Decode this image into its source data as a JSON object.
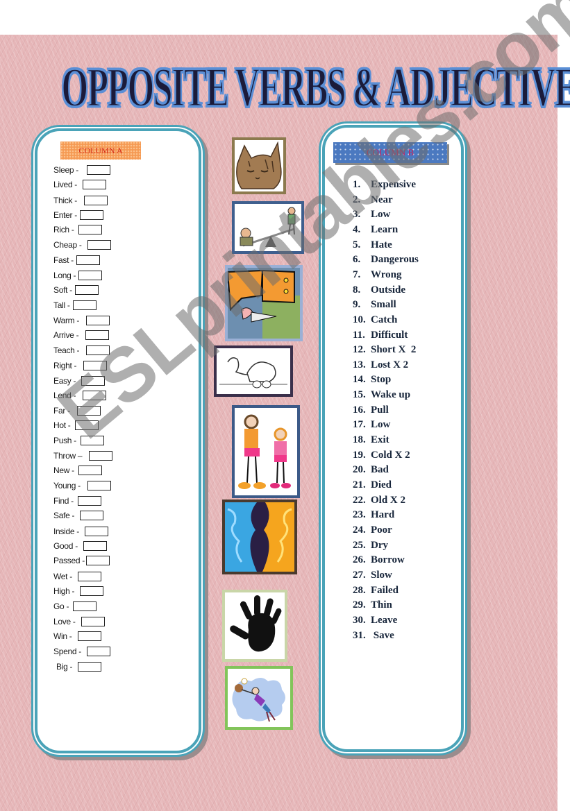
{
  "title": "OPPOSITE VERBS & ADJECTIVES",
  "column_a": {
    "header": "COLUMN A",
    "items": [
      "Sleep -",
      "Lived -",
      "Thick -",
      "Enter -",
      "Rich -",
      "Cheap -",
      "Fast -",
      "Long -",
      "Soft -",
      "Tall -",
      "Warm -",
      "Arrive -",
      "Teach  -",
      "Right -",
      "Easy -",
      "Lend -",
      "Far -",
      "Hot -",
      "Push -",
      "Throw –",
      "New -",
      "Young -",
      "Find -",
      "Safe -",
      "Inside -",
      "Good -",
      "Passed -",
      "Wet -",
      "High -",
      "Go -",
      "Love -",
      "Win -",
      "Spend -",
      "Big -"
    ]
  },
  "column_b": {
    "header": "COLUMN B",
    "items": [
      {
        "num": "1.",
        "word": "Expensive"
      },
      {
        "num": "2.",
        "word": "Near"
      },
      {
        "num": "3.",
        "word": "Low"
      },
      {
        "num": "4.",
        "word": "Learn"
      },
      {
        "num": "5.",
        "word": "Hate"
      },
      {
        "num": "6.",
        "word": "Dangerous"
      },
      {
        "num": "7.",
        "word": "Wrong"
      },
      {
        "num": "8.",
        "word": "Outside"
      },
      {
        "num": "9.",
        "word": "Small"
      },
      {
        "num": "10.",
        "word": "Catch"
      },
      {
        "num": "11.",
        "word": "Difficult"
      },
      {
        "num": "12.",
        "word": "Short X  2"
      },
      {
        "num": "13.",
        "word": "Lost X 2"
      },
      {
        "num": "14.",
        "word": "Stop"
      },
      {
        "num": "15.",
        "word": "Wake up"
      },
      {
        "num": "16.",
        "word": "Pull"
      },
      {
        "num": "17.",
        "word": "Low"
      },
      {
        "num": "18.",
        "word": "Exit"
      },
      {
        "num": "19.",
        "word": "Cold X 2"
      },
      {
        "num": "20.",
        "word": "Bad"
      },
      {
        "num": "21.",
        "word": "Died"
      },
      {
        "num": "22.",
        "word": "Old X 2"
      },
      {
        "num": "23.",
        "word": "Hard"
      },
      {
        "num": "24.",
        "word": "Poor"
      },
      {
        "num": "25.",
        "word": "Dry"
      },
      {
        "num": "26.",
        "word": "Borrow"
      },
      {
        "num": "27.",
        "word": "Slow"
      },
      {
        "num": "28.",
        "word": "Failed"
      },
      {
        "num": "29.",
        "word": "Thin"
      },
      {
        "num": "30.",
        "word": "Leave"
      },
      {
        "num": "31.",
        "word": " Save"
      }
    ]
  },
  "pictures": [
    {
      "name": "sleeping-cat-picture"
    },
    {
      "name": "seesaw-picture"
    },
    {
      "name": "knife-picture"
    },
    {
      "name": "turtle-picture"
    },
    {
      "name": "tall-short-girls-picture"
    },
    {
      "name": "cold-hot-sun-picture"
    },
    {
      "name": "hand-print-picture"
    },
    {
      "name": "girl-catching-ball-picture"
    }
  ],
  "watermark": "ESLprintables.com",
  "colors": {
    "background": "#e6b6b8",
    "panel_border": "#4aa3b8",
    "title_fill": "#5b8fd6",
    "column_a_header_bg": "#f59a53",
    "column_a_header_text": "#d42a1a",
    "column_b_header_bg": "#4b79c0",
    "column_b_header_text": "#c8225a"
  }
}
